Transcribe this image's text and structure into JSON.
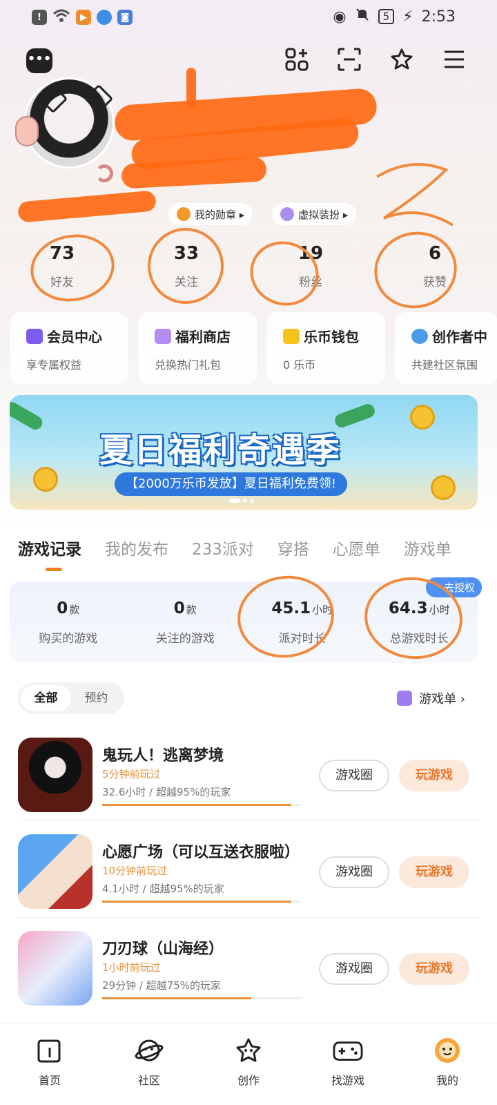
{
  "status_bar": {
    "time": "2:53",
    "battery": "5"
  },
  "profile": {
    "badges": [
      {
        "label": "我的勋章 ▸"
      },
      {
        "label": "虚拟装扮 ▸"
      }
    ],
    "stats": [
      {
        "value": "73",
        "label": "好友"
      },
      {
        "value": "33",
        "label": "关注"
      },
      {
        "value": "19",
        "label": "粉丝"
      },
      {
        "value": "6",
        "label": "获赞"
      }
    ]
  },
  "service_cards": [
    {
      "title": "会员中心",
      "subtitle": "享专属权益",
      "color": "#7d5cf0"
    },
    {
      "title": "福利商店",
      "subtitle": "兑换热门礼包",
      "color": "#b48df2"
    },
    {
      "title": "乐币钱包",
      "subtitle": "0 乐币",
      "color": "#f5c21e"
    },
    {
      "title": "创作者中",
      "subtitle": "共建社区氛围",
      "color": "#4a9be8"
    }
  ],
  "banner": {
    "headline": "夏日福利奇遇季",
    "subline": "【2000万乐币发放】夏日福利免费领!"
  },
  "tabs": [
    "游戏记录",
    "我的发布",
    "233派对",
    "穿搭",
    "心愿单",
    "游戏单"
  ],
  "game_stats": {
    "auth_label": "去授权",
    "items": [
      {
        "value": "0",
        "unit": "款",
        "label": "购买的游戏"
      },
      {
        "value": "0",
        "unit": "款",
        "label": "关注的游戏"
      },
      {
        "value": "45.1",
        "unit": "小时",
        "label": "派对时长"
      },
      {
        "value": "64.3",
        "unit": "小时",
        "label": "总游戏时长"
      }
    ]
  },
  "filter": {
    "all": "全部",
    "reserve": "预约",
    "game_list": "游戏单 ›"
  },
  "games": [
    {
      "name": "鬼玩人！逃离梦境",
      "last_played": "5分钟前玩过",
      "playtime": "32.6小时 / 超越95%的玩家",
      "progress": 0.95,
      "circle_label": "游戏圈",
      "play_label": "玩游戏"
    },
    {
      "name": "心愿广场（可以互送衣服啦）",
      "last_played": "10分钟前玩过",
      "playtime": "4.1小时 / 超越95%的玩家",
      "progress": 0.95,
      "circle_label": "游戏圈",
      "play_label": "玩游戏"
    },
    {
      "name": "刀刃球（山海经）",
      "last_played": "1小时前玩过",
      "playtime": "29分钟 / 超越75%的玩家",
      "progress": 0.75,
      "circle_label": "游戏圈",
      "play_label": "玩游戏"
    }
  ],
  "bottom_nav": [
    {
      "label": "首页",
      "icon": "home-icon"
    },
    {
      "label": "社区",
      "icon": "planet-icon"
    },
    {
      "label": "创作",
      "icon": "star-create-icon"
    },
    {
      "label": "找游戏",
      "icon": "gamepad-icon"
    },
    {
      "label": "我的",
      "icon": "profile-face-icon"
    }
  ],
  "colors": {
    "accent": "#e9913a",
    "annotation": "#f28a3e",
    "scribble": "#ff6a13"
  }
}
